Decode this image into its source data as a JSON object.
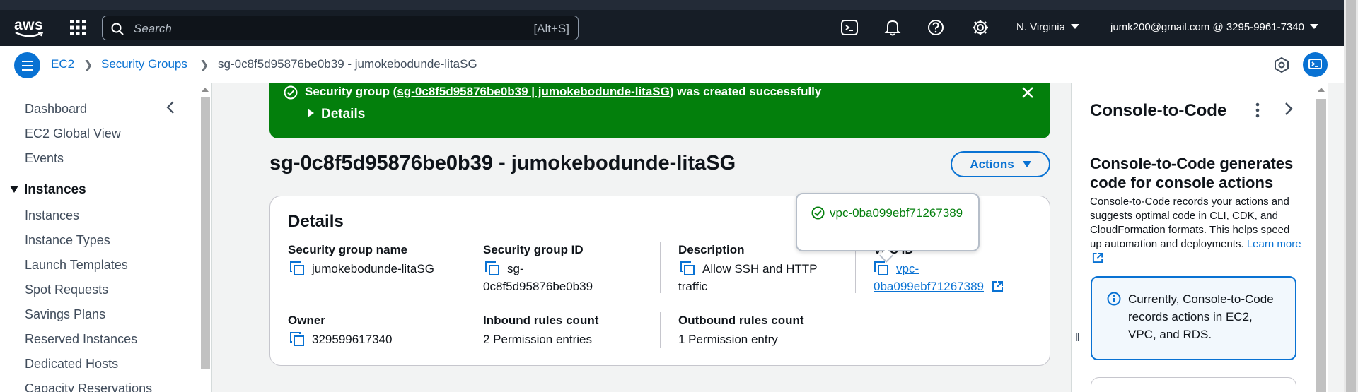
{
  "topnav": {
    "logo_text": "aws",
    "search_placeholder": "Search",
    "search_shortcut": "[Alt+S]",
    "region": "N. Virginia",
    "account": "jumk200@gmail.com @ 3295-9961-7340",
    "icons": [
      "cloudshell-icon",
      "bell-icon",
      "help-icon",
      "gear-icon"
    ]
  },
  "breadcrumb": {
    "items": [
      "EC2",
      "Security Groups",
      "sg-0c8f5d95876be0b39 - jumokebodunde-litaSG"
    ]
  },
  "sidebar": {
    "items": [
      "Dashboard",
      "EC2 Global View",
      "Events"
    ],
    "section": "Instances",
    "section_items": [
      "Instances",
      "Instance Types",
      "Launch Templates",
      "Spot Requests",
      "Savings Plans",
      "Reserved Instances",
      "Dedicated Hosts",
      "Capacity Reservations"
    ]
  },
  "flash": {
    "prefix": "Security group (",
    "link": "sg-0c8f5d95876be0b39 | jumokebodunde-litaSG",
    "suffix": ") was created successfully",
    "details": "Details"
  },
  "page": {
    "title": "sg-0c8f5d95876be0b39 - jumokebodunde-litaSG",
    "actions": "Actions"
  },
  "details": {
    "title": "Details",
    "sg_name_label": "Security group name",
    "sg_name": "jumokebodunde-litaSG",
    "sg_id_label": "Security group ID",
    "sg_id_1": "sg-",
    "sg_id_2": "0c8f5d95876be0b39",
    "desc_label": "Description",
    "desc_1": "Allow SSH and HTTP",
    "desc_2": "traffic",
    "vpc_label": "VPC ID",
    "vpc_1": "vpc-",
    "vpc_2": "0ba099ebf71267389",
    "owner_label": "Owner",
    "owner": "329599617340",
    "inbound_label": "Inbound rules count",
    "inbound": "2 Permission entries",
    "outbound_label": "Outbound rules count",
    "outbound": "1 Permission entry"
  },
  "tooltip": {
    "text": "vpc-0ba099ebf71267389"
  },
  "right_panel": {
    "title": "Console-to-Code",
    "heading": "Console-to-Code generates code for console actions",
    "body": "Console-to-Code records your actions and suggests optimal code in CLI, CDK, and CloudFormation formats. This helps speed up automation and deployments.",
    "learn_more": "Learn more",
    "info": "Currently, Console-to-Code records actions in EC2, VPC, and RDS."
  },
  "colors": {
    "nav_bg": "#161d26",
    "link": "#0972d3",
    "success": "#037f0c"
  }
}
